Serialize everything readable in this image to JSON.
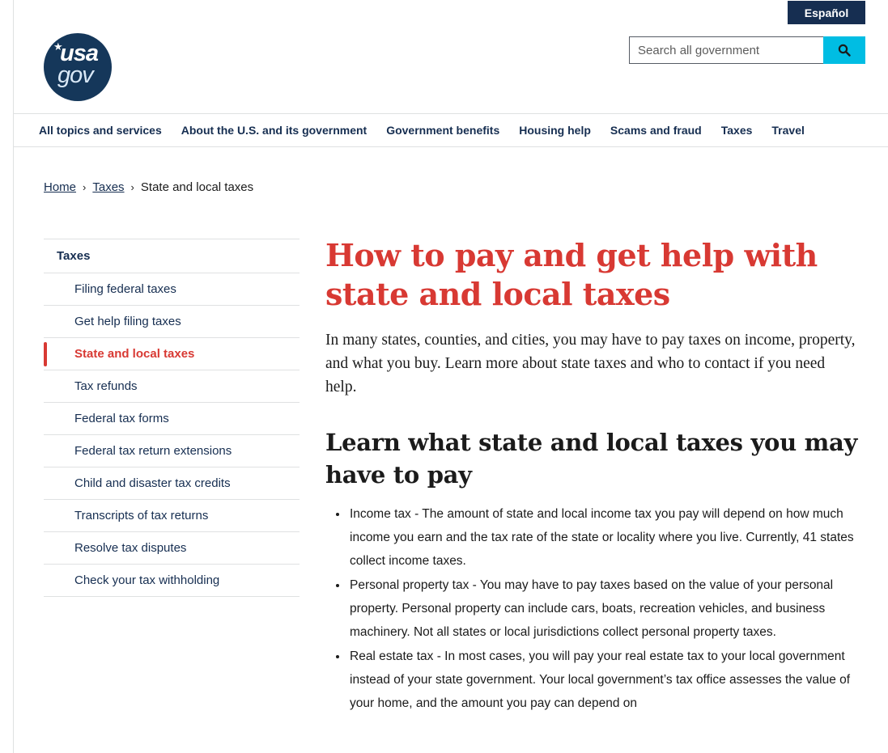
{
  "header": {
    "language_toggle": "Español",
    "logo": {
      "line1": "usa",
      "line2": "gov"
    },
    "search": {
      "placeholder": "Search all government"
    }
  },
  "nav": {
    "items": [
      "All topics and services",
      "About the U.S. and its government",
      "Government benefits",
      "Housing help",
      "Scams and fraud",
      "Taxes",
      "Travel"
    ]
  },
  "breadcrumb": {
    "home": "Home",
    "taxes": "Taxes",
    "current": "State and local taxes",
    "separator": "›"
  },
  "sidenav": {
    "parent": "Taxes",
    "items": [
      "Filing federal taxes",
      "Get help filing taxes",
      "State and local taxes",
      "Tax refunds",
      "Federal tax forms",
      "Federal tax return extensions",
      "Child and disaster tax credits",
      "Transcripts of tax returns",
      "Resolve tax disputes",
      "Check your tax withholding"
    ],
    "current_index": 2
  },
  "main": {
    "title": "How to pay and get help with state and local taxes",
    "intro": "In many states, counties, and cities, you may have to pay taxes on income, property, and what you buy. Learn more about state taxes and who to contact if you need help.",
    "section_heading": "Learn what state and local taxes you may have to pay",
    "list": [
      "Income tax - The amount of state and local income tax you pay will depend on how much income you earn and the tax rate of the state or locality where you live. Currently, 41 states collect income taxes.",
      "Personal property tax - You may have to pay taxes based on the value of your personal property. Personal property can include cars, boats, recreation vehicles, and business machinery. Not all states or local jurisdictions collect personal property taxes.",
      "Real estate tax - In most cases, you will pay your real estate tax to your local government instead of your state government. Your local government’s tax office assesses the value of your home, and the amount you pay can depend on"
    ]
  },
  "colors": {
    "navy": "#162e51",
    "accent_red": "#d83933",
    "search_button": "#00bde3",
    "logo_bg": "#15375a"
  },
  "icons": {
    "search": "search-icon",
    "logo_star": "star-icon"
  }
}
